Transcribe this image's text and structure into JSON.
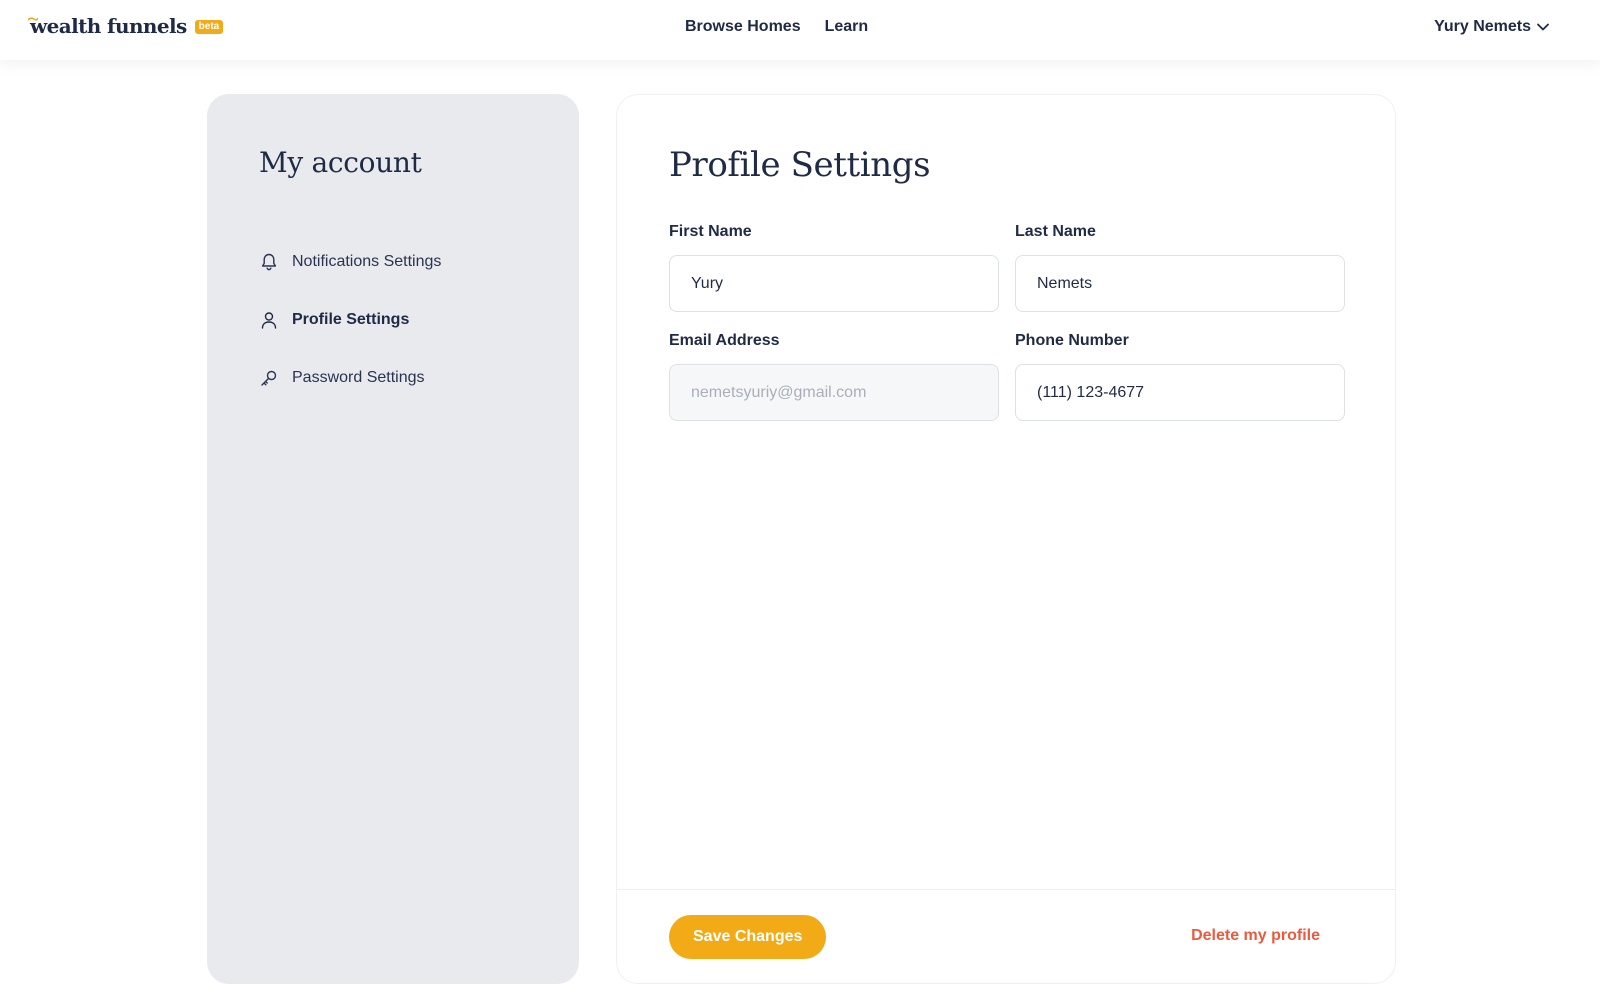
{
  "header": {
    "logo_text": "wealth funnels",
    "beta_label": "beta",
    "nav": [
      {
        "label": "Browse Homes"
      },
      {
        "label": "Learn"
      }
    ],
    "user_name": "Yury Nemets",
    "user_menu_icon": "chevron-down-icon"
  },
  "sidebar": {
    "title": "My account",
    "items": [
      {
        "label": "Notifications Settings",
        "icon": "bell-icon",
        "active": false
      },
      {
        "label": "Profile Settings",
        "icon": "user-icon",
        "active": true
      },
      {
        "label": "Password Settings",
        "icon": "key-icon",
        "active": false
      }
    ]
  },
  "profile": {
    "title": "Profile Settings",
    "first_name": {
      "label": "First Name",
      "value": "Yury"
    },
    "last_name": {
      "label": "Last Name",
      "value": "Nemets"
    },
    "email": {
      "label": "Email Address",
      "placeholder": "nemetsyuriy@gmail.com"
    },
    "phone": {
      "label": "Phone Number",
      "value": "(111) 123-4677"
    },
    "save_label": "Save Changes",
    "delete_label": "Delete my profile"
  },
  "colors": {
    "accent": "#f2aa16",
    "danger": "#ea5a3f",
    "text": "#1f2a44",
    "sidebar_bg": "#e8eaee"
  }
}
